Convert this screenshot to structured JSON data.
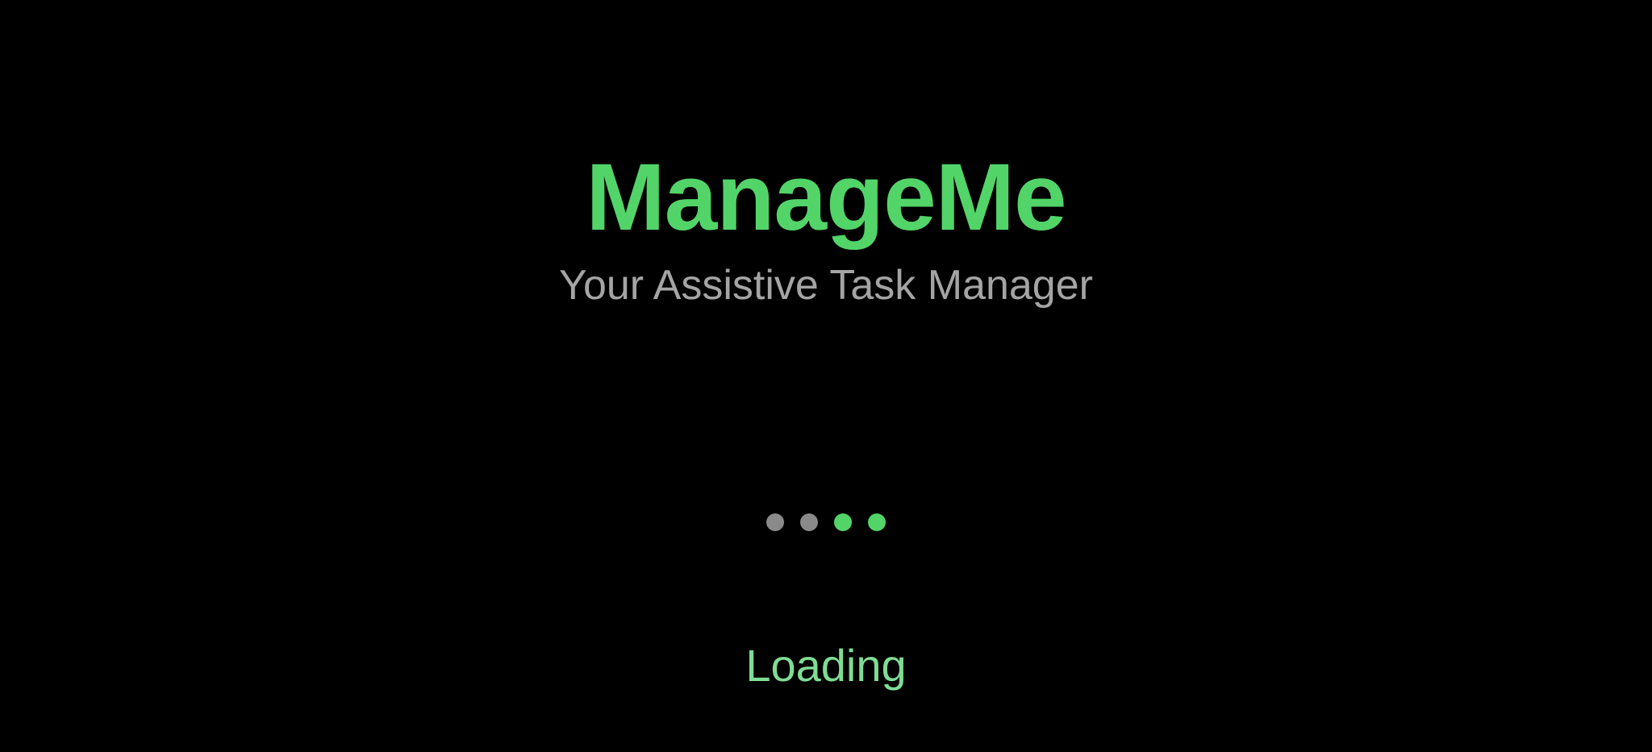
{
  "app": {
    "title": "ManageMe",
    "subtitle": "Your Assistive Task Manager"
  },
  "loader": {
    "dots": [
      {
        "state": "inactive",
        "color": "#8a8a8a"
      },
      {
        "state": "inactive",
        "color": "#8a8a8a"
      },
      {
        "state": "active",
        "color": "#52d468"
      },
      {
        "state": "active",
        "color": "#52d468"
      }
    ],
    "label": "Loading"
  },
  "colors": {
    "background": "#000000",
    "accent": "#52d468",
    "subtitle": "#a4a4a4",
    "loading_text": "#7fdc94"
  }
}
